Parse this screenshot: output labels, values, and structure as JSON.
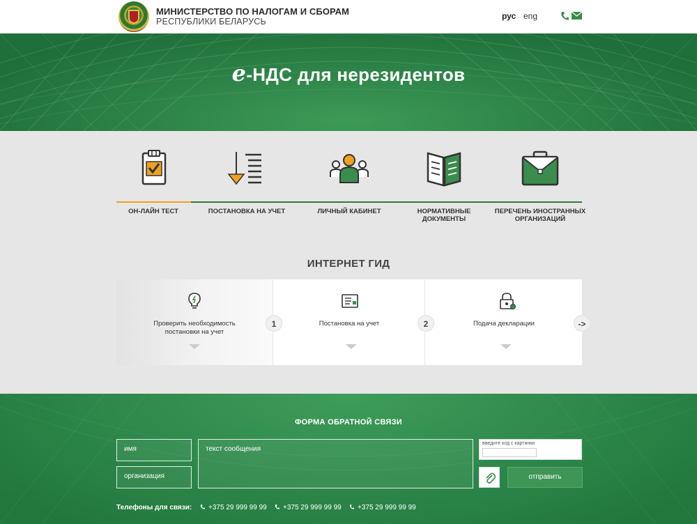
{
  "header": {
    "org_line1": "МИНИСТЕРСТВО ПО НАЛОГАМ И СБОРАМ",
    "org_line2": "РЕСПУБЛИКИ БЕЛАРУСЬ",
    "lang_ru": "рус",
    "lang_en": "eng"
  },
  "hero": {
    "title_e": "e",
    "title_rest": "-НДС для нерезидентов"
  },
  "nav": {
    "items": [
      {
        "label": "ОН-ЛАЙН ТЕСТ",
        "icon": "checklist-icon",
        "active": true
      },
      {
        "label": "ПОСТАНОВКА НА УЧЕТ",
        "icon": "register-icon"
      },
      {
        "label": "ЛИЧНЫЙ КАБИНЕТ",
        "icon": "users-icon"
      },
      {
        "label": "НОРМАТИВНЫЕ ДОКУМЕНТЫ",
        "icon": "book-icon"
      },
      {
        "label": "ПЕРЕЧЕНЬ ИНОСТРАННЫХ ОРГАНИЗАЦИЙ",
        "icon": "briefcase-icon"
      }
    ],
    "accent_color": "#f0a020",
    "line_color": "#2e7d3a"
  },
  "guide": {
    "title": "ИНТЕРНЕТ ГИД",
    "cards": [
      {
        "label": "Проверить необходимость постановки на учет",
        "icon": "lightbulb-icon"
      },
      {
        "label": "Постановка на учет",
        "icon": "document-icon"
      },
      {
        "label": "Подача декларации",
        "icon": "lock-icon"
      }
    ],
    "steps": [
      "1",
      "2",
      "->"
    ]
  },
  "feedback": {
    "title": "ФОРМА ОБРАТНОЙ СВЯЗИ",
    "name_placeholder": "имя",
    "org_placeholder": "организация",
    "message_placeholder": "текст сообщения",
    "captcha_label": "введите код с картинки",
    "send_label": "отправить",
    "phones_label": "Телефоны для связи:",
    "phones": [
      "+375 29 999 99 99",
      "+375 29 999 99 99",
      "+375 29 999 99 99"
    ]
  },
  "colors": {
    "brand_green": "#2e8448",
    "background": "#e6e6e6"
  }
}
